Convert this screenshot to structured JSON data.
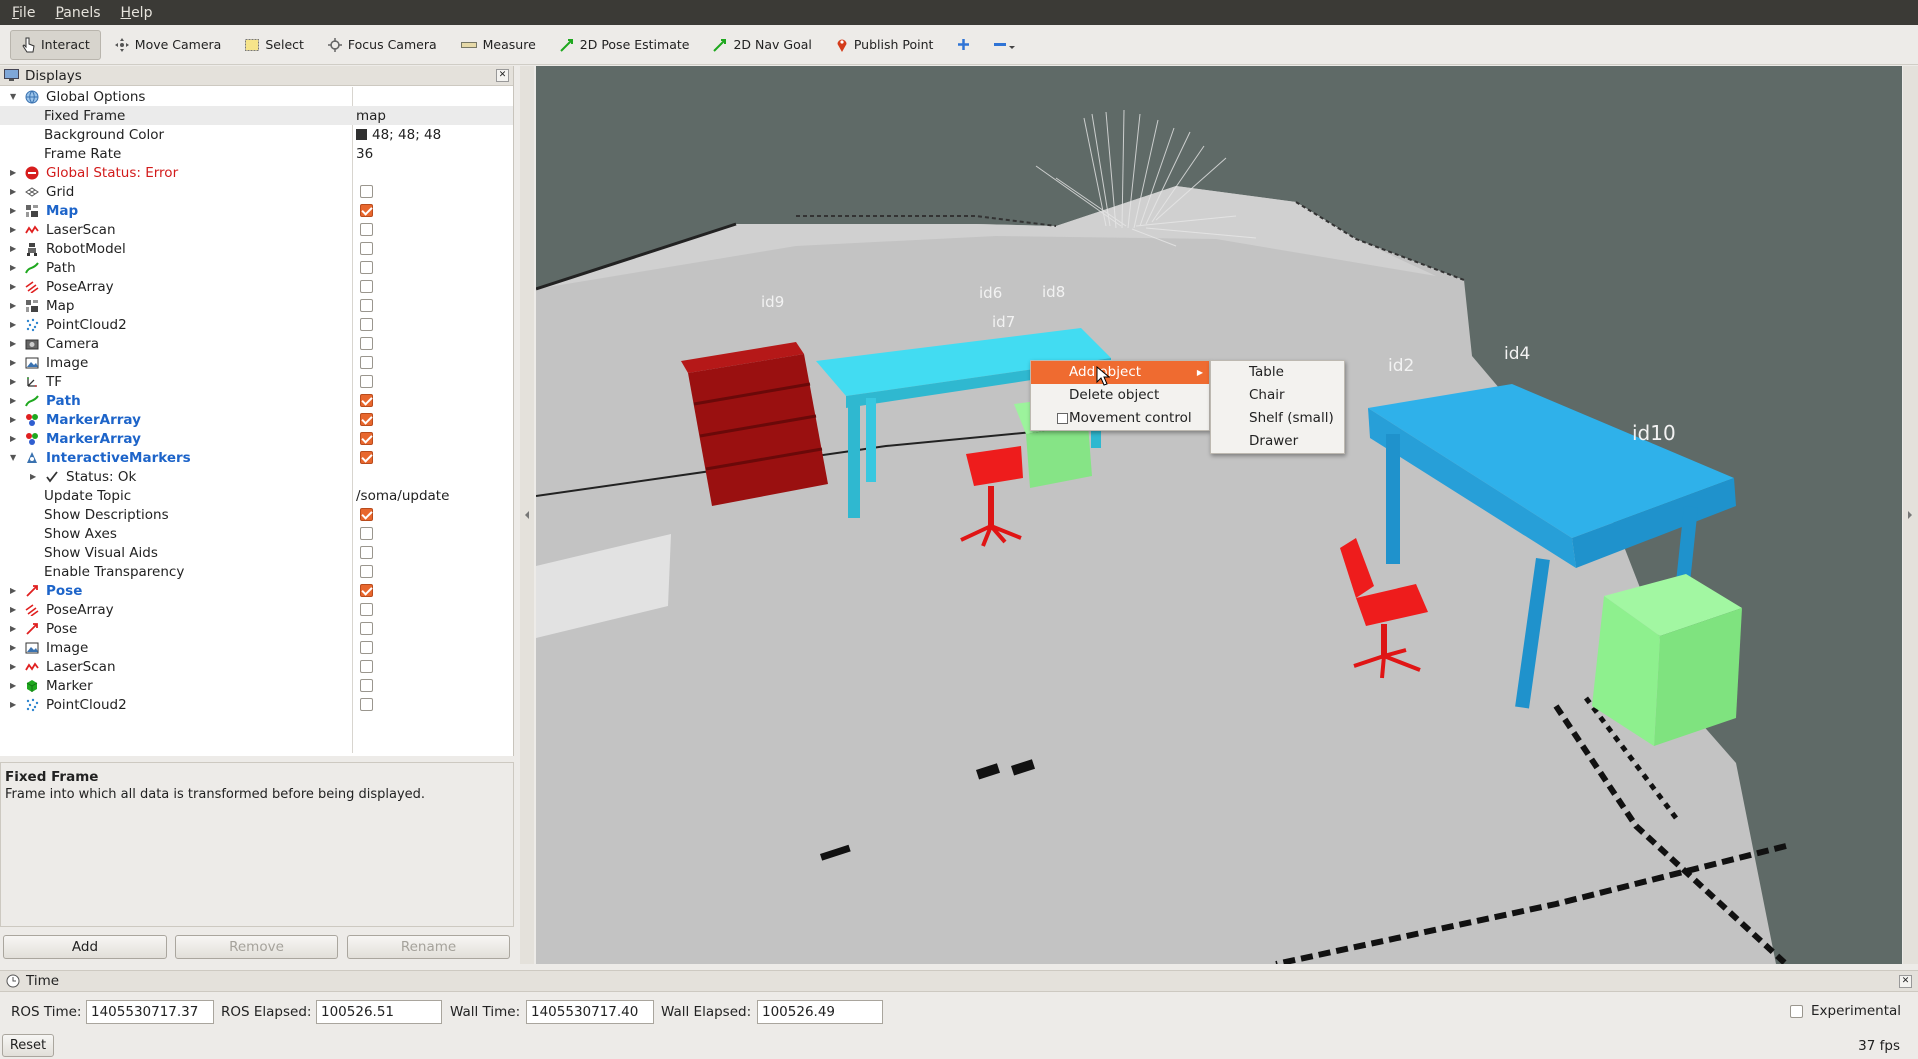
{
  "menubar": {
    "items": [
      "File",
      "Panels",
      "Help"
    ]
  },
  "toolbar": {
    "tools": [
      {
        "label": "Interact",
        "icon": "cursor-icon"
      },
      {
        "label": "Move Camera",
        "icon": "move-camera-icon"
      },
      {
        "label": "Select",
        "icon": "select-icon"
      },
      {
        "label": "Focus Camera",
        "icon": "focus-camera-icon"
      },
      {
        "label": "Measure",
        "icon": "measure-icon"
      },
      {
        "label": "2D Pose Estimate",
        "icon": "pose-estimate-arrow-icon"
      },
      {
        "label": "2D Nav Goal",
        "icon": "nav-goal-arrow-icon"
      },
      {
        "label": "Publish Point",
        "icon": "map-pin-icon"
      }
    ],
    "extra_icons": [
      "plus-icon",
      "minus-dropdown-icon"
    ]
  },
  "displays_panel": {
    "title": "Displays",
    "rows": [
      {
        "label": "Global Options",
        "icon": "globe-icon",
        "depth": 0,
        "expanded": true
      },
      {
        "label": "Fixed Frame",
        "value": "map",
        "depth": 1,
        "selected": true
      },
      {
        "label": "Background Color",
        "value": "48; 48; 48",
        "depth": 1,
        "swatch": "#303030"
      },
      {
        "label": "Frame Rate",
        "value": "36",
        "depth": 1
      },
      {
        "label": "Global Status: Error",
        "icon": "error-icon",
        "depth": 0,
        "style": "red"
      },
      {
        "label": "Grid",
        "icon": "grid-icon",
        "depth": 0,
        "checked": false
      },
      {
        "label": "Map",
        "icon": "map-icon",
        "depth": 0,
        "checked": true,
        "style": "blue"
      },
      {
        "label": "LaserScan",
        "icon": "laserscan-icon",
        "depth": 0,
        "checked": false
      },
      {
        "label": "RobotModel",
        "icon": "robot-icon",
        "depth": 0,
        "checked": false
      },
      {
        "label": "Path",
        "icon": "path-icon",
        "depth": 0,
        "checked": false
      },
      {
        "label": "PoseArray",
        "icon": "posearray-icon",
        "depth": 0,
        "checked": false
      },
      {
        "label": "Map",
        "icon": "map-icon",
        "depth": 0,
        "checked": false
      },
      {
        "label": "PointCloud2",
        "icon": "pointcloud-icon",
        "depth": 0,
        "checked": false
      },
      {
        "label": "Camera",
        "icon": "camera-icon",
        "depth": 0,
        "checked": false
      },
      {
        "label": "Image",
        "icon": "image-icon",
        "depth": 0,
        "checked": false
      },
      {
        "label": "TF",
        "icon": "tf-icon",
        "depth": 0,
        "checked": false
      },
      {
        "label": "Path",
        "icon": "path-icon",
        "depth": 0,
        "checked": true,
        "style": "blue"
      },
      {
        "label": "MarkerArray",
        "icon": "markerarray-icon",
        "depth": 0,
        "checked": true,
        "style": "blue"
      },
      {
        "label": "MarkerArray",
        "icon": "markerarray-icon",
        "depth": 0,
        "checked": true,
        "style": "blue"
      },
      {
        "label": "InteractiveMarkers",
        "icon": "interactive-markers-icon",
        "depth": 0,
        "checked": true,
        "style": "blue",
        "expanded": true
      },
      {
        "label": "Status: Ok",
        "icon": "checkmark-icon",
        "depth": 1,
        "collapsed": true
      },
      {
        "label": "Update Topic",
        "value": "/soma/update",
        "depth": 1
      },
      {
        "label": "Show Descriptions",
        "depth": 1,
        "checked": true
      },
      {
        "label": "Show Axes",
        "depth": 1,
        "checked": false
      },
      {
        "label": "Show Visual Aids",
        "depth": 1,
        "checked": false
      },
      {
        "label": "Enable Transparency",
        "depth": 1,
        "checked": false
      },
      {
        "label": "Pose",
        "icon": "pose-icon",
        "depth": 0,
        "checked": true,
        "style": "blue"
      },
      {
        "label": "PoseArray",
        "icon": "posearray-icon",
        "depth": 0,
        "checked": false
      },
      {
        "label": "Pose",
        "icon": "pose-icon",
        "depth": 0,
        "checked": false
      },
      {
        "label": "Image",
        "icon": "image-icon",
        "depth": 0,
        "checked": false
      },
      {
        "label": "LaserScan",
        "icon": "laserscan-icon",
        "depth": 0,
        "checked": false
      },
      {
        "label": "Marker",
        "icon": "marker-icon",
        "depth": 0,
        "checked": false
      },
      {
        "label": "PointCloud2",
        "icon": "pointcloud-icon",
        "depth": 0,
        "checked": false
      }
    ]
  },
  "help": {
    "title": "Fixed Frame",
    "description": "Frame into which all data is transformed before being displayed."
  },
  "panel_buttons": {
    "add": "Add",
    "remove": "Remove",
    "rename": "Rename"
  },
  "viewport": {
    "labels": [
      "id9",
      "id6",
      "id8",
      "id7",
      "id2",
      "id4",
      "id10"
    ],
    "colors": {
      "background": "#5f6a67",
      "floor": "#c4c4c4",
      "table": "#3cc0ee",
      "shelf": "#9c1212",
      "chair": "#ee1c1c",
      "drawer": "#8ef08e"
    }
  },
  "context_menu": {
    "items": [
      "Add object",
      "Delete object",
      "Movement control"
    ],
    "submenu": [
      "Table",
      "Chair",
      "Shelf (small)",
      "Drawer"
    ]
  },
  "time_panel": {
    "title": "Time",
    "ros_time_label": "ROS Time:",
    "ros_time": "1405530717.37",
    "ros_elapsed_label": "ROS Elapsed:",
    "ros_elapsed": "100526.51",
    "wall_time_label": "Wall Time:",
    "wall_time": "1405530717.40",
    "wall_elapsed_label": "Wall Elapsed:",
    "wall_elapsed": "100526.49",
    "experimental": "Experimental"
  },
  "statusbar": {
    "reset": "Reset",
    "fps": "37 fps"
  }
}
